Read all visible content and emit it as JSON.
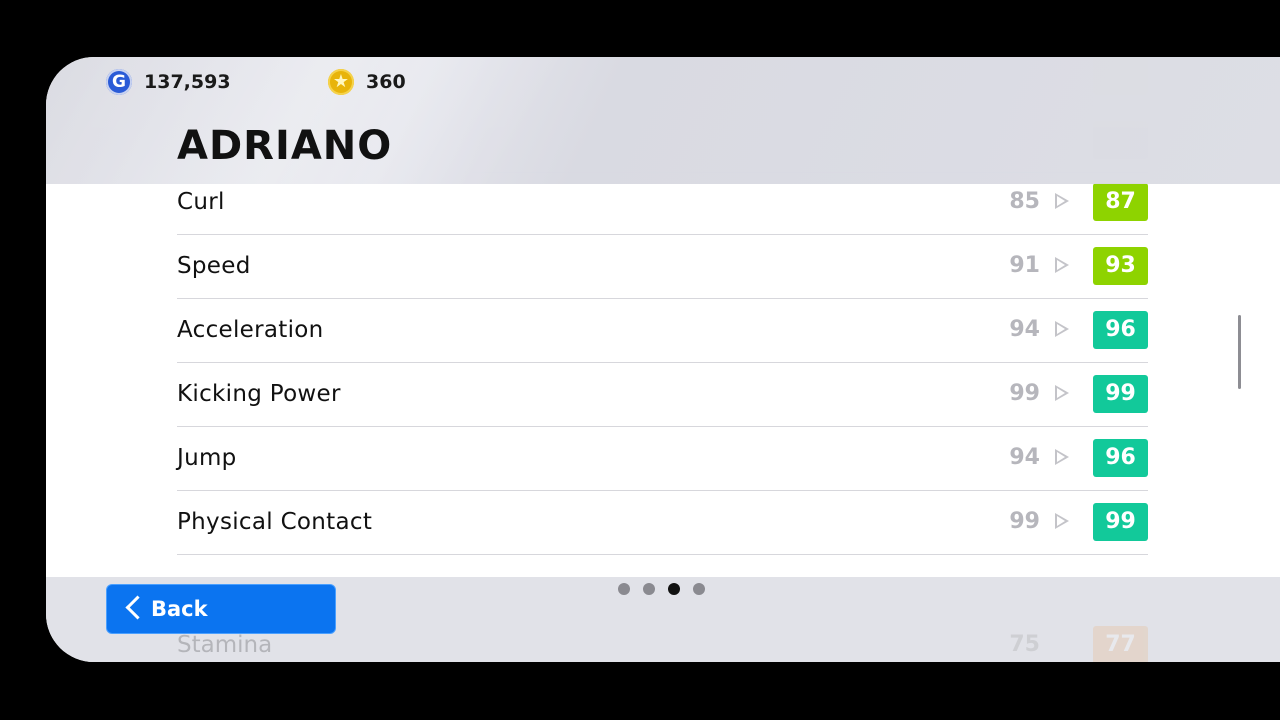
{
  "currency": {
    "gp": "137,593",
    "coins": "360",
    "gp_icon": "G"
  },
  "player": {
    "name": "ADRIANO"
  },
  "stats": [
    {
      "label": "Curl",
      "base": "85",
      "boosted": "87",
      "color": "#8ed300"
    },
    {
      "label": "Speed",
      "base": "91",
      "boosted": "93",
      "color": "#8ed300"
    },
    {
      "label": "Acceleration",
      "base": "94",
      "boosted": "96",
      "color": "#12c99a"
    },
    {
      "label": "Kicking Power",
      "base": "99",
      "boosted": "99",
      "color": "#12c99a"
    },
    {
      "label": "Jump",
      "base": "94",
      "boosted": "96",
      "color": "#12c99a"
    },
    {
      "label": "Physical Contact",
      "base": "99",
      "boosted": "99",
      "color": "#12c99a"
    }
  ],
  "hidden_rows": [
    {
      "label": "Stamina",
      "base": "75",
      "boosted": "77",
      "color": "#e9b27a"
    }
  ],
  "navigation": {
    "back_label": "Back",
    "pages": 4,
    "active_page": 3
  },
  "scroll": {
    "position": 0.45
  }
}
